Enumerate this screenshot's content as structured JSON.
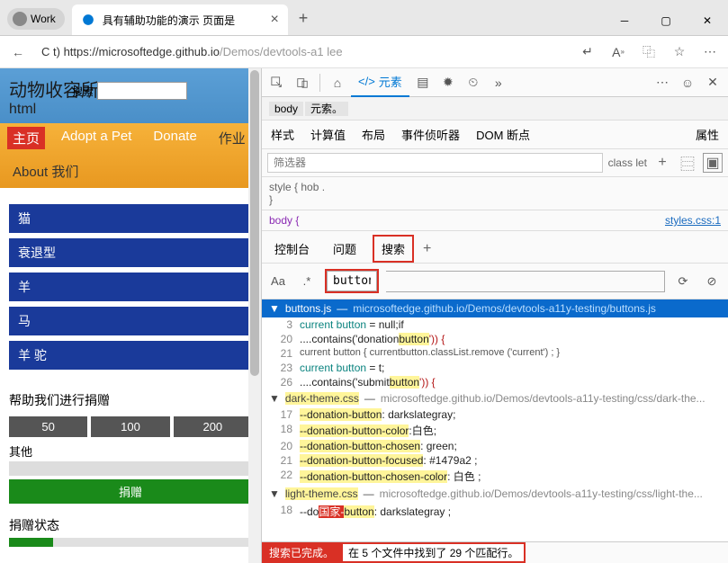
{
  "titlebar": {
    "profile": "Work",
    "tab_title": "具有辅助功能的演示 页面是"
  },
  "addrbar": {
    "prefix": "C t) ",
    "url_dark": "https://microsoftedge.github.io",
    "url_rest": "/Demos/devtools-a1 lee"
  },
  "page": {
    "title": "动物收容所",
    "subtitle": "html",
    "search_label": "搜索",
    "nav": [
      "主页",
      "Adopt a Pet",
      "Donate",
      "作业",
      "About 我们"
    ],
    "side_items": [
      "猫",
      "衰退型",
      "羊",
      "马",
      "羊 驼"
    ],
    "donate_title": "帮助我们进行捐赠",
    "donate_opts": [
      "50",
      "100",
      "200"
    ],
    "donate_other": "其他",
    "donate_submit": "捐赠",
    "status_title": "捐赠状态"
  },
  "devtools": {
    "elements_tab": "元素",
    "crumb1": "body",
    "crumb2": "元索。",
    "subtabs": [
      "样式",
      "计算值",
      "布局",
      "事件侦听器",
      "DOM 断点",
      "属性"
    ],
    "filter_ph": "筛选器",
    "filter_lbl": "class let",
    "style_txt": "style { hob .",
    "brace": "}",
    "body_txt": "body {",
    "body_link": "styles.css:1"
  },
  "drawer": {
    "tabs": [
      "控制台",
      "问题",
      "搜索"
    ],
    "aa": "Aa",
    "regex": ".*",
    "query": "button"
  },
  "results": {
    "file1": {
      "name": "buttons.js",
      "path": "microsoftedge.github.io/Demos/devtools-a11y-testing/buttons.js"
    },
    "f1_lines": [
      {
        "n": "3",
        "pre": "current button",
        "mid": " = null;if",
        "post": ""
      },
      {
        "n": "20",
        "pre": "....contains('donation",
        "hl": "button",
        "post": "')) {"
      },
      {
        "n": "21",
        "plain": "current button { currentbutton.classList.remove ('current') ; }"
      },
      {
        "n": "23",
        "pre": "current button",
        "mid": " = t;",
        "post": ""
      },
      {
        "n": "26",
        "pre": "....contains('submit",
        "hl": "button",
        "post": "')) {"
      }
    ],
    "file2": {
      "name": "dark-theme.css",
      "path": "microsoftedge.github.io/Demos/devtools-a11y-testing/css/dark-the..."
    },
    "f2_lines": [
      {
        "n": "17",
        "k": "--donation-button",
        "v": ": darkslategray;"
      },
      {
        "n": "18",
        "k": "--donation-button-color",
        "v": ":白色;"
      },
      {
        "n": "20",
        "k": "--donation-button-chosen",
        "v": ": green;"
      },
      {
        "n": "21",
        "k": "--donation-button-focused",
        "v": ": #1479a2 ;"
      },
      {
        "n": "22",
        "k": "--donation-button-chosen-color",
        "v": ": 白色 ;"
      }
    ],
    "file3": {
      "name": "light-theme.css",
      "path": "microsoftedge.github.io/Demos/devtools-a11y-testing/css/light-the..."
    },
    "f3_lines": [
      {
        "n": "18",
        "k": "--do",
        "strike": "国家-",
        "hl": "button",
        "v": ": darkslategray ;"
      }
    ]
  },
  "status": {
    "left": "搜索已完成。",
    "right": "在 5 个文件中找到了 29 个匹配行。"
  }
}
